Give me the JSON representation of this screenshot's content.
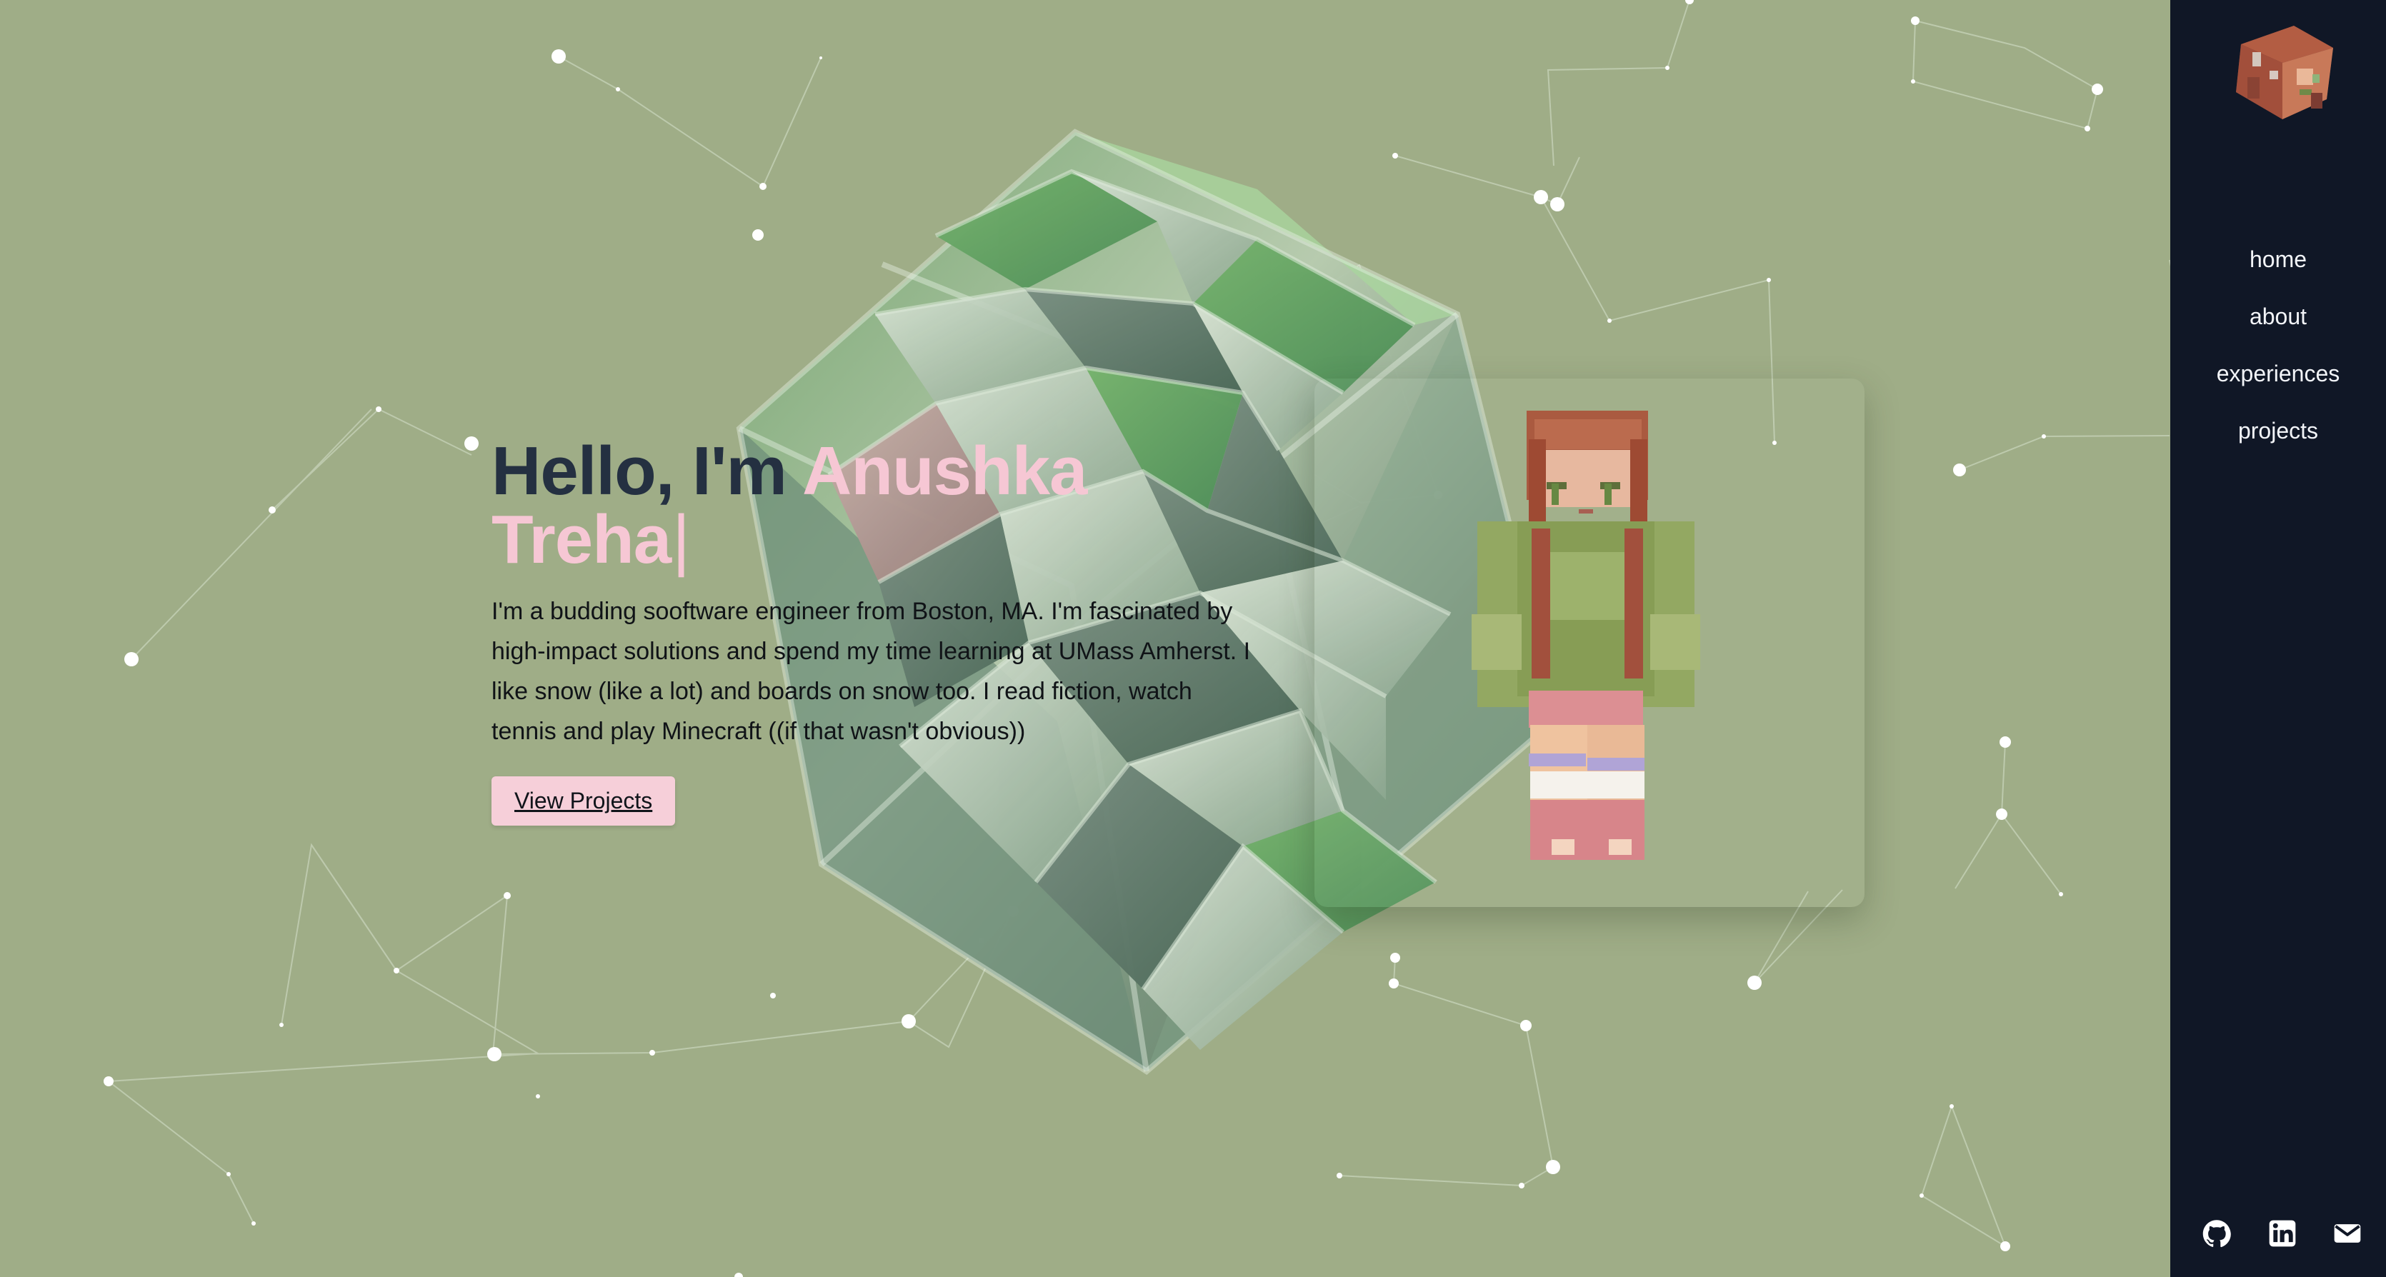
{
  "hero": {
    "greeting": "Hello, I'm ",
    "name_line_1": "Anushka",
    "name_line_2": "Treha",
    "cursor": "|",
    "description": "I'm a budding sooftware engineer from Boston, MA. I'm fascinated by high-impact solutions and spend my time learning at UMass Amherst. I like snow (like a lot) and boards on snow too. I read fiction, watch tennis and play Minecraft ((if that wasn't obvious))",
    "button_label": "View Projects"
  },
  "sidebar": {
    "nav": [
      {
        "label": "home"
      },
      {
        "label": "about"
      },
      {
        "label": "experiences"
      },
      {
        "label": "projects"
      }
    ],
    "social_icons": [
      "github-icon",
      "linkedin-icon",
      "mail-icon"
    ]
  },
  "colors": {
    "page_background": "#9fad87",
    "sidebar_background": "#101726",
    "accent_pink": "#f6c7d4",
    "title_dark": "#243041",
    "body_text": "#101317"
  }
}
